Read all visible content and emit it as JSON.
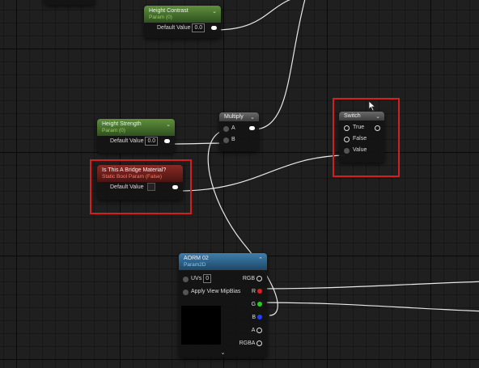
{
  "nodes": {
    "height_contrast": {
      "title": "Height Contrast",
      "subtitle": "Param (0)",
      "default_label": "Default Value",
      "value": "0.0"
    },
    "height_strength": {
      "title": "Height Strength",
      "subtitle": "Param (0)",
      "default_label": "Default Value",
      "value": "0.0"
    },
    "bridge_material": {
      "title": "Is This A Bridge Material?",
      "subtitle": "Static Bool Param (False)",
      "default_label": "Default Value"
    },
    "multiply": {
      "title": "Multiply",
      "pin_a": "A",
      "pin_b": "B"
    },
    "switch": {
      "title": "Switch",
      "pin_true": "True",
      "pin_false": "False",
      "pin_value": "Value"
    },
    "aorm": {
      "title": "AORM 02",
      "subtitle": "Param2D",
      "uvs_label": "UVs",
      "uvs_value": "0",
      "apply_view_mip_bias": "Apply View MipBias",
      "outputs": [
        "RGB",
        "R",
        "G",
        "B",
        "A",
        "RGBA"
      ]
    }
  },
  "colors": {
    "highlight": "#d41f1f",
    "param_green": "#5f8f3c",
    "static_bool_red": "#8a2a24",
    "texture_blue": "#3e7fae",
    "pin_r": "#e02020",
    "pin_g": "#20d020",
    "pin_b": "#2040ff"
  }
}
